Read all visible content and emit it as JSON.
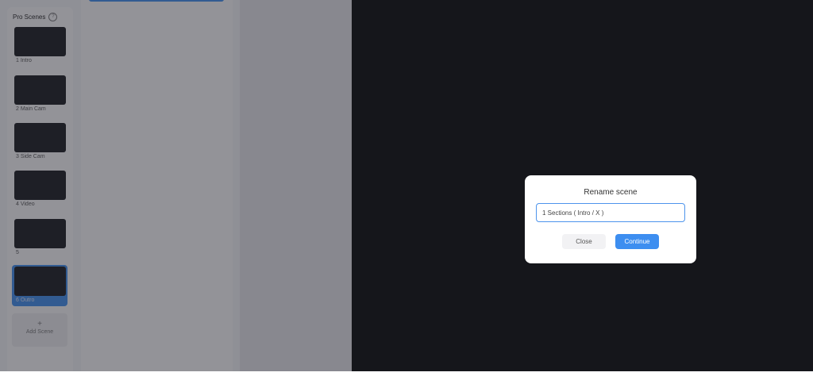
{
  "scenes_panel": {
    "title": "Pro Scenes",
    "help_icon": "?",
    "scenes": [
      {
        "label": "1 Intro"
      },
      {
        "label": "2 Main Cam"
      },
      {
        "label": "3 Side Cam"
      },
      {
        "label": "4 Video"
      },
      {
        "label": "5"
      },
      {
        "label": "6 Outro"
      }
    ],
    "add_scene": {
      "icon": "+",
      "label": "Add Scene"
    }
  },
  "modal": {
    "title": "Rename scene",
    "input_value": "1 Sections ( Intro / X )",
    "close_label": "Close",
    "continue_label": "Continue"
  },
  "colors": {
    "accent": "#3d8ef0",
    "canvas": "#15161b"
  }
}
